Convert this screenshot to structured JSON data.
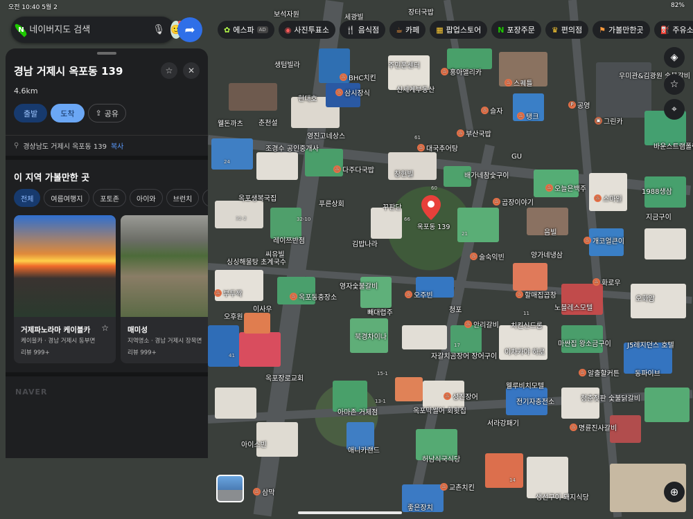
{
  "status": {
    "time": "오전 10:40",
    "date": "5월 2",
    "battery": "82%"
  },
  "search": {
    "placeholder": "네이버지도 검색",
    "mic_icon": "mic-icon",
    "avatar_icon": "avatar-icon"
  },
  "categories": [
    {
      "label": "에스파",
      "icon": "aespa-icon",
      "ad": "AD"
    },
    {
      "label": "사진투표소",
      "icon": "photo-vote-icon"
    },
    {
      "label": "음식점",
      "icon": "restaurant-icon"
    },
    {
      "label": "카페",
      "icon": "cafe-icon"
    },
    {
      "label": "팝업스토어",
      "icon": "popup-store-icon"
    },
    {
      "label": "포장주문",
      "icon": "takeout-icon"
    },
    {
      "label": "편의점",
      "icon": "convenience-icon"
    },
    {
      "label": "가볼만한곳",
      "icon": "attraction-icon"
    },
    {
      "label": "주유소",
      "icon": "gas-station-icon"
    }
  ],
  "panel": {
    "title": "경남 거제시 옥포동 139",
    "distance": "4.6km",
    "departure_label": "출발",
    "arrival_label": "도착",
    "share_label": "공유",
    "address": "경상남도 거제시 옥포동 139",
    "copy_label": "복사",
    "section_title": "이 지역 가볼만한 곳",
    "filters": [
      "전체",
      "여름여행지",
      "포토존",
      "아이와",
      "브런치",
      "오"
    ],
    "cards": [
      {
        "name": "거제파노라마 케이블카",
        "sub": "케이블카 · 경남 거제시 동부면",
        "reviews": "리뷰 999+"
      },
      {
        "name": "매미성",
        "sub": "지역명소 · 경남 거제시 장목면",
        "reviews": "리뷰 999+"
      }
    ],
    "brand": "NAVER"
  },
  "marker": {
    "label": "옥포동 139"
  },
  "map_labels": [
    "보석자원",
    "세광빌",
    "장터국밥",
    "상수원",
    "생텀빌라",
    "BHC치킨",
    "주민폰센터",
    "홍아앨리카",
    "스퀘틀",
    "우미관&김광원 숯불갈비",
    "삼시장식",
    "신세계부동산",
    "슬자",
    "탱크",
    "공영",
    "그린카",
    "현대호",
    "웰돈까츠",
    "춘천설",
    "영진고네상스",
    "부산국밥",
    "대국추어탕",
    "GU",
    "바운스트램폴린",
    "조경수 공인중개사",
    "다주다국밥",
    "창현빌",
    "배가네참숯구이",
    "오늘은백주",
    "스마일",
    "1988생삼",
    "옥포생복국집",
    "푸른상회",
    "꾸판단",
    "곱장이야기",
    "음빌",
    "지금구이",
    "레이쯔반점",
    "김밥나라",
    "개코얼큰이",
    "씨유빌",
    "술숙익빈",
    "양가네냉삼",
    "싱싱해물탕 초계국수",
    "부두짝",
    "영자숯불갈비",
    "화로우",
    "할매집곱창",
    "노블레스모텔",
    "오화암",
    "옥포동충장소",
    "오주빈",
    "청포",
    "빼대렵주",
    "안리갈비",
    "치킨신드롬",
    "오후원",
    "이사우",
    "북경차이나",
    "마싼집 왕소금구이",
    "J5레지던스 호텔",
    "자갈치곰장어 장어구이",
    "이차카야 하로",
    "알출할커튼",
    "옥포장로교회",
    "웰루비치모텔",
    "동파이브",
    "성진장어",
    "전기자충전소",
    "청춘젖판 숯불닭갈비",
    "아마존 거제점",
    "옥포막썰어 회횟집",
    "서라강패기",
    "명륜진사갈비",
    "아이스빈",
    "애니카랜드",
    "허남식국식당",
    "교촌치킨",
    "삼막",
    "생선구이 돼지식당",
    "좋은장치"
  ]
}
